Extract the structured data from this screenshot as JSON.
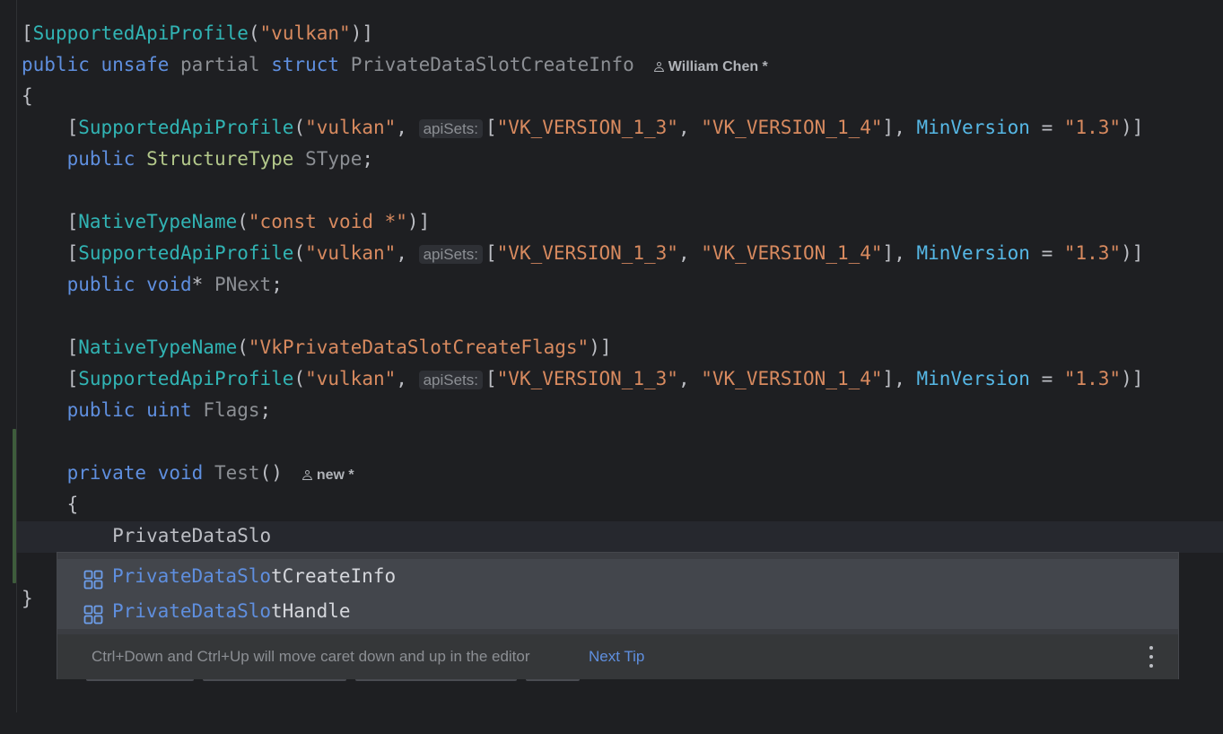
{
  "code": {
    "line1": {
      "open": "[",
      "attr": "SupportedApiProfile",
      "paren_open": "(",
      "str": "\"vulkan\"",
      "close": ")]"
    },
    "line2": {
      "kw1": "public",
      "kw2": "unsafe",
      "kw3": "partial",
      "kw4": "struct",
      "name": "PrivateDataSlotCreateInfo",
      "author": "William Chen *"
    },
    "line3": {
      "brace": "{"
    },
    "profile_attr": {
      "open": "[",
      "attr": "SupportedApiProfile",
      "paren_open": "(",
      "str1": "\"vulkan\"",
      "comma": ", ",
      "hint": "apiSets:",
      "arr_open": "[",
      "str2": "\"VK_VERSION_1_3\"",
      "str3": "\"VK_VERSION_1_4\"",
      "arr_close": "], ",
      "named": "MinVersion",
      "eq": " = ",
      "str4": "\"1.3\"",
      "close": ")]"
    },
    "field1": {
      "kw": "public",
      "type": "StructureType",
      "name": "SType",
      "semi": ";"
    },
    "native1": {
      "open": "[",
      "attr": "NativeTypeName",
      "paren_open": "(",
      "str": "\"const void *\"",
      "close": ")]"
    },
    "field2": {
      "kw1": "public",
      "kw2": "void",
      "star": "*",
      "name": "PNext",
      "semi": ";"
    },
    "native2": {
      "open": "[",
      "attr": "NativeTypeName",
      "paren_open": "(",
      "str": "\"VkPrivateDataSlotCreateFlags\"",
      "close": ")]"
    },
    "field3": {
      "kw1": "public",
      "kw2": "uint",
      "name": "Flags",
      "semi": ";"
    },
    "method": {
      "kw1": "private",
      "kw2": "void",
      "name": "Test",
      "parens": "()",
      "author": "new *"
    },
    "method_brace": "{",
    "typing": "PrivateDataSlo",
    "close_brace": "}"
  },
  "completion": {
    "items": [
      {
        "match": "PrivateDataSlo",
        "rest": "tCreateInfo",
        "icon": "struct-icon"
      },
      {
        "match": "PrivateDataSlo",
        "rest": "tHandle",
        "icon": "struct-icon"
      }
    ],
    "tip": "Ctrl+Down and Ctrl+Up will move caret down and up in the editor",
    "next_tip": "Next Tip",
    "more_icon": "vertical-ellipsis-icon"
  }
}
